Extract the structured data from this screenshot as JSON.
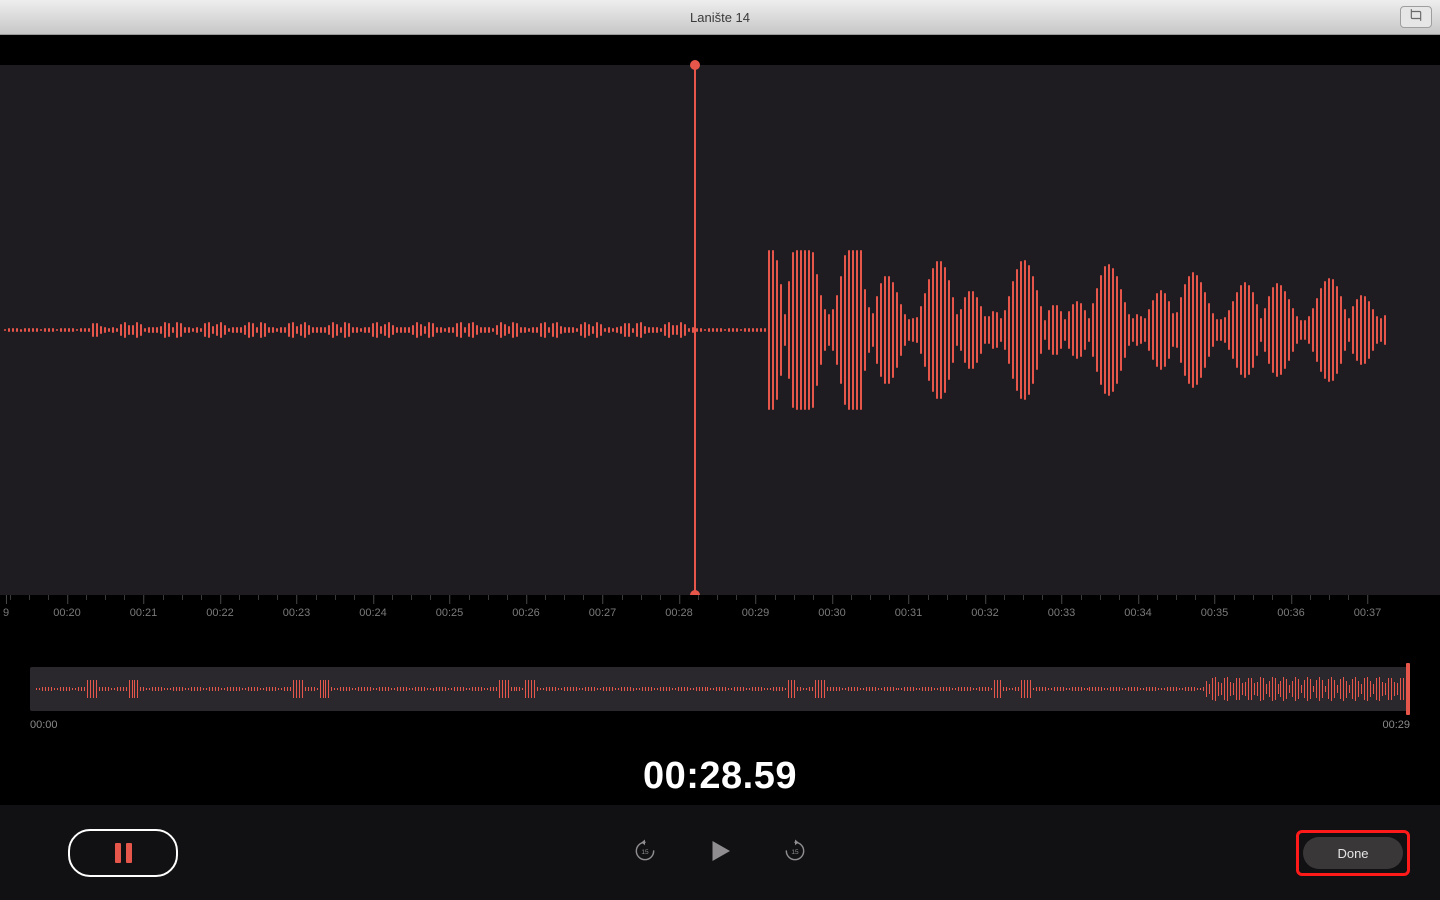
{
  "window": {
    "title": "Lanište 14"
  },
  "timeline": {
    "ticks": [
      "00:20",
      "00:21",
      "00:22",
      "00:23",
      "00:24",
      "00:25",
      "00:26",
      "00:27",
      "00:28",
      "00:29",
      "00:30",
      "00:31",
      "00:32",
      "00:33",
      "00:34",
      "00:35",
      "00:36",
      "00:37"
    ],
    "lead_label_fragment": "9",
    "playhead_seconds": 28.59
  },
  "overview": {
    "start_label": "00:00",
    "end_label": "00:29"
  },
  "display_time": "00:28.59",
  "controls": {
    "skip_back_seconds": 15,
    "skip_forward_seconds": 15,
    "done_label": "Done"
  },
  "colors": {
    "accent": "#e6564a",
    "bg_panel": "#1f1c21"
  },
  "icons": {
    "crop": "crop-icon",
    "pause": "pause-icon",
    "skip_back": "skip-back-15-icon",
    "play": "play-icon",
    "skip_forward": "skip-forward-15-icon"
  }
}
